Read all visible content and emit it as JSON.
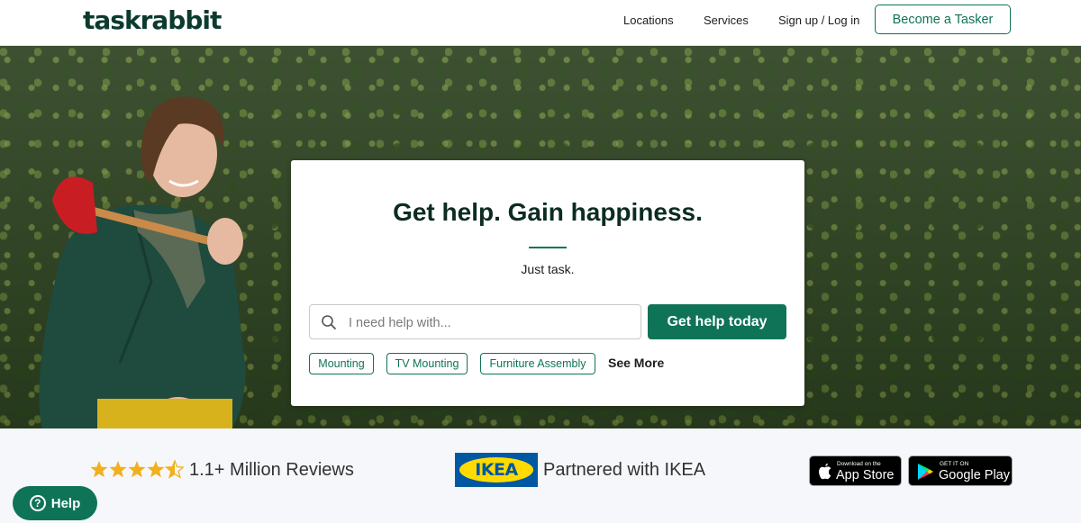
{
  "header": {
    "logo": "taskrabbit",
    "nav": [
      "Locations",
      "Services",
      "Sign up / Log in"
    ],
    "cta": "Become a Tasker"
  },
  "hero": {
    "title": "Get help. Gain happiness.",
    "subtitle": "Just task.",
    "search_placeholder": "I need help with...",
    "search_button": "Get help today",
    "chips": [
      "Mounting",
      "TV Mounting",
      "Furniture Assembly"
    ],
    "see_more": "See More"
  },
  "trust": {
    "rating_stars": 4.5,
    "reviews_text": "1.1+ Million Reviews",
    "ikea_logo": "IKEA",
    "partner_text": "Partnered with IKEA",
    "app_store_small": "Download on the",
    "app_store_big": "App Store",
    "google_small": "GET IT ON",
    "google_big": "Google Play"
  },
  "help_button": "Help",
  "colors": {
    "brand_green": "#0f7358",
    "dark_green": "#0c2c22",
    "ikea_blue": "#0058a3",
    "ikea_yellow": "#ffdb00",
    "star": "#f2b01e"
  }
}
